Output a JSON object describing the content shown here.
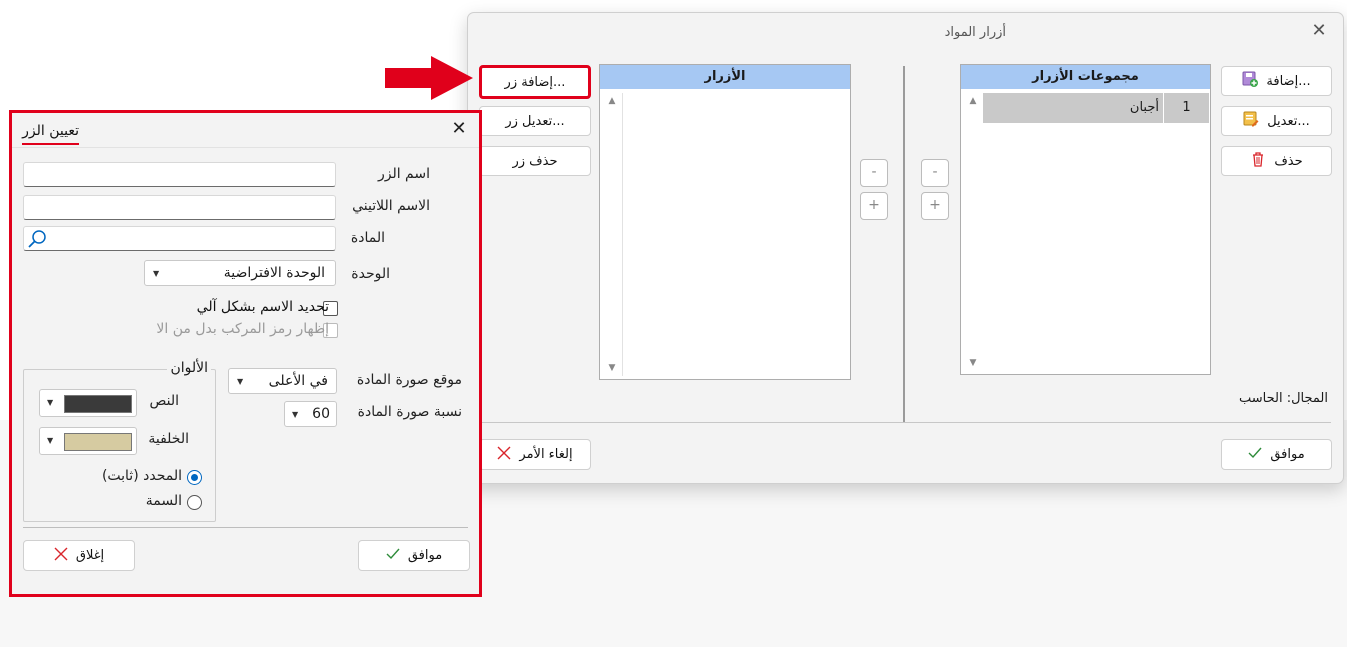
{
  "main_dialog": {
    "title": "أزرار المواد",
    "groups_panel": {
      "header": "مجموعات الأزرار",
      "rows": [
        {
          "num": "1",
          "name": "أجبان"
        }
      ]
    },
    "buttons_panel": {
      "header": "الأزرار"
    },
    "group_actions": {
      "add": "إضافة...",
      "edit": "تعديل...",
      "delete": "حذف"
    },
    "button_actions": {
      "add": "إضافة زر...",
      "edit": "تعديل زر...",
      "delete": "حذف زر"
    },
    "mini": {
      "minus": "-",
      "plus": "+"
    },
    "scope_label": "المجال: الحاسب",
    "ok": "موافق",
    "cancel": "إلغاء الأمر"
  },
  "assign_dialog": {
    "title": "تعيين الزر",
    "button_name_label": "اسم الزر",
    "latin_name_label": "الاسم اللاتيني",
    "material_label": "المادة",
    "unit_label": "الوحدة",
    "unit_value": "الوحدة الافتراضية",
    "auto_name": "تحديد الاسم بشكل آلي",
    "show_code": "إظهار رمز المركب بدل من الا",
    "colors_group": "الألوان",
    "text_color_label": "النص",
    "text_color": "#3a3a3a",
    "bg_color_label": "الخلفية",
    "bg_color": "#d6cba1",
    "radio_fixed": "المحدد (ثابت)",
    "radio_theme": "السمة",
    "image_pos_label": "موقع صورة المادة",
    "image_pos_value": "في الأعلى",
    "image_ratio_label": "نسبة صورة المادة",
    "image_ratio_value": "60",
    "ok": "موافق",
    "close": "إغلاق"
  },
  "colors": {
    "accent_red": "#e0001b",
    "header_blue": "#a6c8f3",
    "ok_green": "#2e8b3a",
    "cancel_red": "#d9252b"
  }
}
